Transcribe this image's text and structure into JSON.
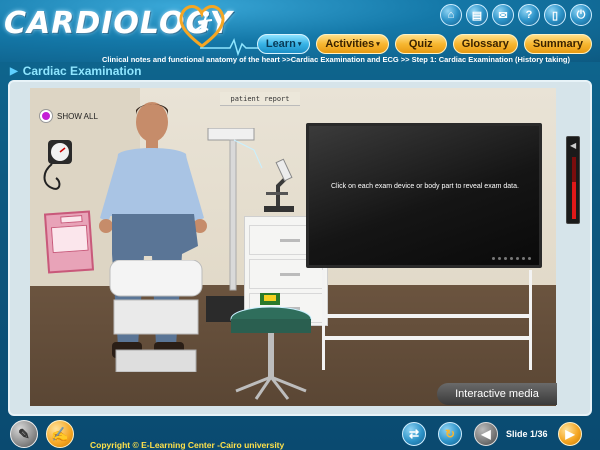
{
  "app": {
    "logo_text": "CARDIOLOGY"
  },
  "top_icons": [
    {
      "name": "home-icon",
      "glyph": "⌂"
    },
    {
      "name": "print-icon",
      "glyph": "▤"
    },
    {
      "name": "mail-icon",
      "glyph": "✉"
    },
    {
      "name": "help-icon",
      "glyph": "?"
    },
    {
      "name": "document-icon",
      "glyph": "▯"
    },
    {
      "name": "exit-icon",
      "glyph": "⏻"
    }
  ],
  "nav": {
    "learn": "Learn",
    "activities": "Activities",
    "quiz": "Quiz",
    "glossary": "Glossary",
    "summary": "Summary",
    "dropdown_caret": "▾"
  },
  "breadcrumb": "Clinical notes and functional anatomy of the heart >>Cardiac Examination and ECG >> Step 1: Cardiac Examination (History taking)",
  "section_title": "Cardiac Examination",
  "scene": {
    "patient_report_label": "patient report",
    "show_all_label": "SHOW ALL",
    "monitor_text": "Click on each exam device or body part to reveal exam data.",
    "interactive_media_label": "Interactive media",
    "volume_level": 0.6
  },
  "footer": {
    "copyright": "Copyright © E-Learning Center -Cairo university",
    "slide_counter": "Slide 1/36"
  }
}
